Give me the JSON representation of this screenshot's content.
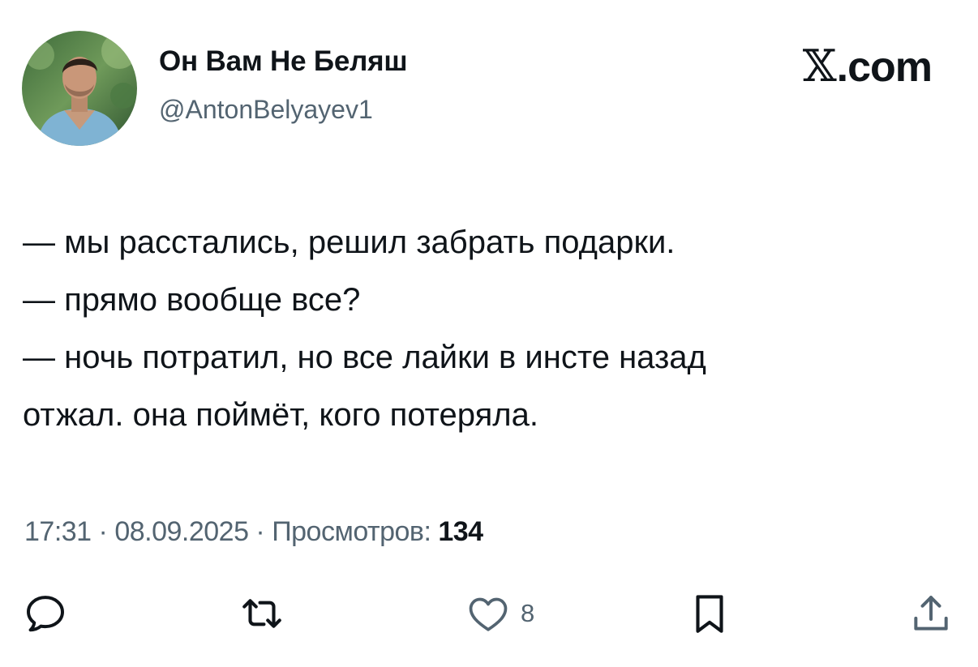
{
  "author": {
    "display_name": "Он Вам Не Беляш",
    "handle": "@AntonBelyayev1",
    "avatar_icon": "profile-photo"
  },
  "brand": {
    "mark": "𝕏",
    "suffix": ".com"
  },
  "tweet": {
    "lines": [
      "— мы расстались, решил забрать подарки.",
      "— прямо вообще все?",
      "— ночь потратил, но все лайки в инсте назад",
      "отжал. она поймёт, кого потеряла."
    ]
  },
  "meta": {
    "time": "17:31",
    "separator": " · ",
    "date": "08.09.2025",
    "views_label": "Просмотров:",
    "views_count": "134"
  },
  "actions": {
    "reply": {
      "icon": "reply-icon"
    },
    "retweet": {
      "icon": "retweet-icon"
    },
    "like": {
      "icon": "heart-icon",
      "count": "8"
    },
    "bookmark": {
      "icon": "bookmark-icon"
    },
    "share": {
      "icon": "share-icon"
    }
  },
  "colors": {
    "text_primary": "#0f1419",
    "text_secondary": "#536471",
    "background": "#ffffff"
  }
}
